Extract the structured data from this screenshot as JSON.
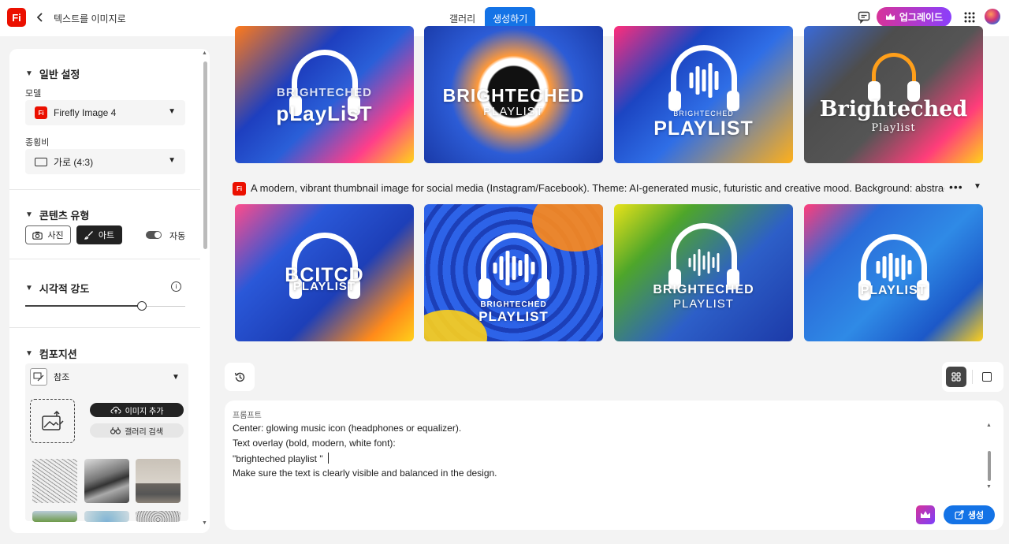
{
  "app": {
    "logo": "Fi",
    "breadcrumb": "텍스트를 이미지로"
  },
  "nav": {
    "tabs": [
      {
        "label": "갤러리",
        "active": false
      },
      {
        "label": "생성하기",
        "active": true
      }
    ]
  },
  "header": {
    "upgrade_label": "업그레이드"
  },
  "sidebar": {
    "general": {
      "title": "일반 설정",
      "model_label": "모델",
      "model_value": "Firefly Image 4",
      "ratio_label": "종횡비",
      "ratio_value": "가로 (4:3)"
    },
    "content_type": {
      "title": "콘텐츠 유형",
      "photo": "사진",
      "art": "아트",
      "auto": "자동",
      "selected": "art"
    },
    "visual_intensity": {
      "title": "시각적 강도",
      "value": 0.73
    },
    "composition": {
      "title": "컴포지션",
      "reference": "참조",
      "add_image": "이미지 추가",
      "gallery_search": "갤러리 검색"
    }
  },
  "results": {
    "prompt_summary": "A modern, vibrant thumbnail image for social media (Instagram/Facebook). Theme: AI-generated music, futuristic and creative mood. Background: abstract",
    "row1": [
      {
        "line1": "BRIGHTECHED",
        "line2": "pLayLisT"
      },
      {
        "line1": "BRIGHTECHED",
        "line2": "PLAYLIST"
      },
      {
        "line1": "BRIGHTECHED",
        "line2": "PLAYLIST"
      },
      {
        "line1": "Brighteched",
        "line2": "Playlist"
      }
    ],
    "row2": [
      {
        "line1": "BCITCD",
        "line2": "PLAYLIST"
      },
      {
        "line1": "BRIGHTECHED",
        "line2": "PLAYLIST"
      },
      {
        "line1": "BRIGHTECHED",
        "line2": "PLAYLIST"
      },
      {
        "line1": "",
        "line2": "PLAYLIST"
      }
    ]
  },
  "prompt": {
    "label": "프롬프트",
    "lines": [
      "Center: glowing music icon (headphones or equalizer).",
      "Text overlay (bold, modern, white font):",
      "\"brighteched playlist \"",
      "Make sure the text is clearly visible and balanced in the design."
    ],
    "generate_label": "생성"
  },
  "icons": [
    "back-chevron-icon",
    "chat-icon",
    "crown-icon",
    "apps-grid-icon",
    "history-icon",
    "grid-view-icon",
    "single-view-icon",
    "camera-icon",
    "brush-icon",
    "info-icon",
    "upload-image-icon",
    "cloud-upload-icon",
    "binoculars-icon",
    "more-icon"
  ],
  "colors": {
    "accent": "#1473e6",
    "brand": "#eb1000",
    "upgrade_start": "#d73399",
    "upgrade_end": "#8a3ffc"
  }
}
